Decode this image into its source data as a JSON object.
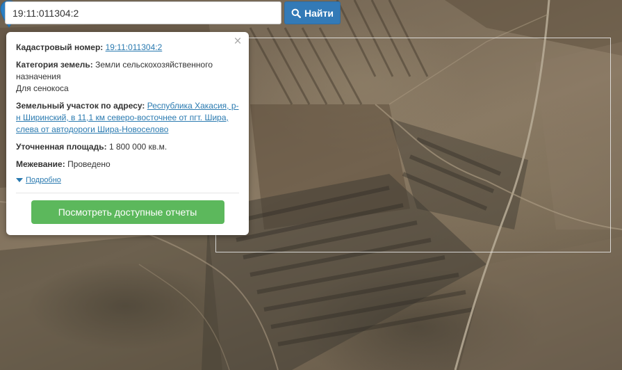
{
  "search": {
    "value": "19:11:011304:2",
    "button_label": "Найти",
    "button_icon": "search-icon"
  },
  "popup": {
    "cadastral_label": "Кадастровый номер:",
    "cadastral_value": "19:11:011304:2",
    "category_label": "Категория земель:",
    "category_value": "Земли сельскохозяйственного назначения",
    "usage": "Для сенокоса",
    "address_label": "Земельный участок по адресу:",
    "address_value": "Республика Хакасия, р-н Ширинский, в 11,1 км северо-восточнее от пгт. Шира, слева от автодороги Шира-Новоселово",
    "area_label": "Уточненная площадь:",
    "area_value": "1 800 000 кв.м.",
    "survey_label": "Межевание:",
    "survey_value": "Проведено",
    "details_label": "Подробно",
    "report_button_label": "Посмотреть доступные отчеты",
    "close_icon": "close-icon"
  },
  "colors": {
    "search_button": "#337ab7",
    "report_button": "#5cb85c",
    "link": "#2a7ab0",
    "marker": "#2b7fc3"
  }
}
